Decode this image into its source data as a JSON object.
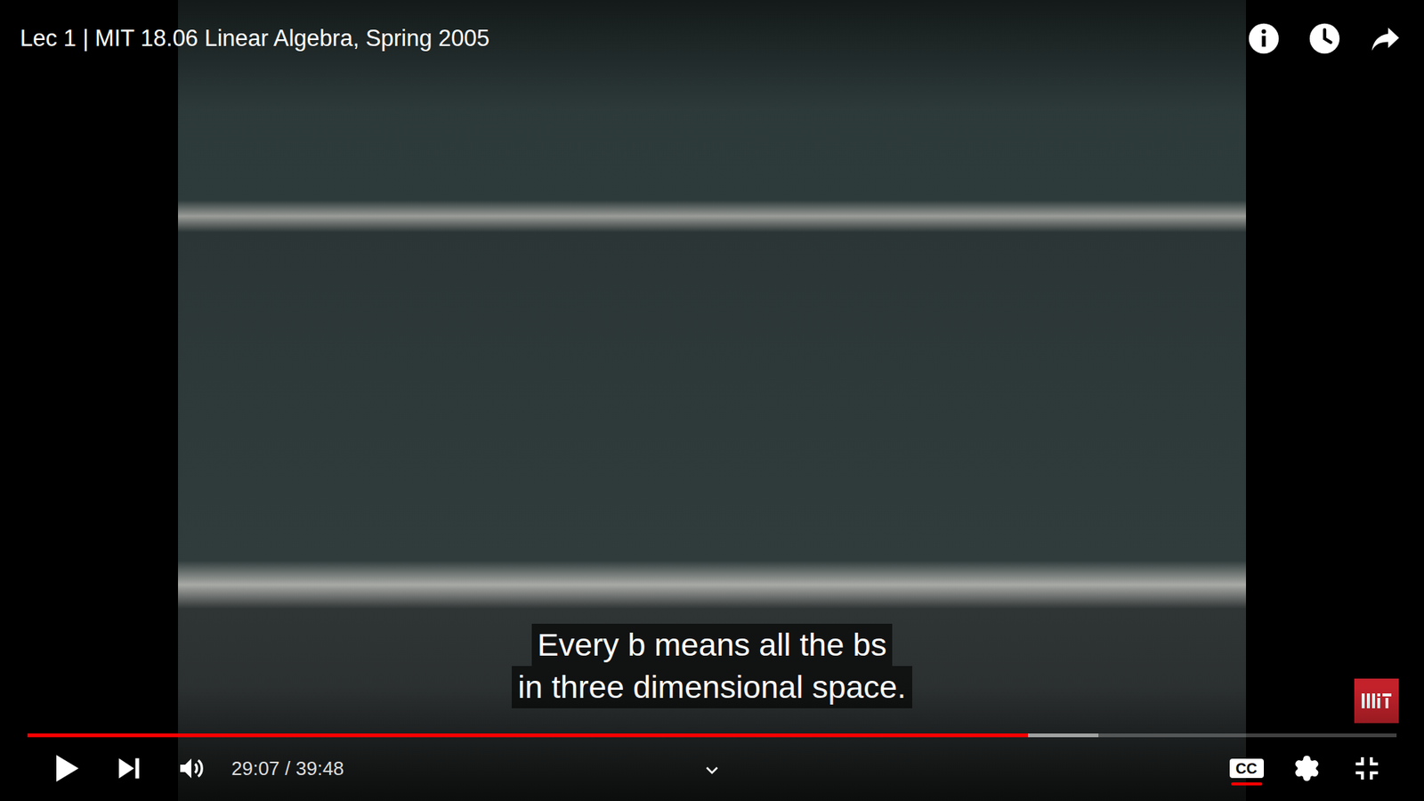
{
  "player": {
    "title": "Lec 1 | MIT 18.06 Linear Algebra, Spring 2005",
    "playing": false
  },
  "captions": [
    "Every b means all the bs",
    "in three dimensional space."
  ],
  "progress": {
    "level": 0.731,
    "buffered": 0.782
  },
  "time": "29:07 / 39:48",
  "cc": {
    "label": "CC",
    "on": true
  }
}
